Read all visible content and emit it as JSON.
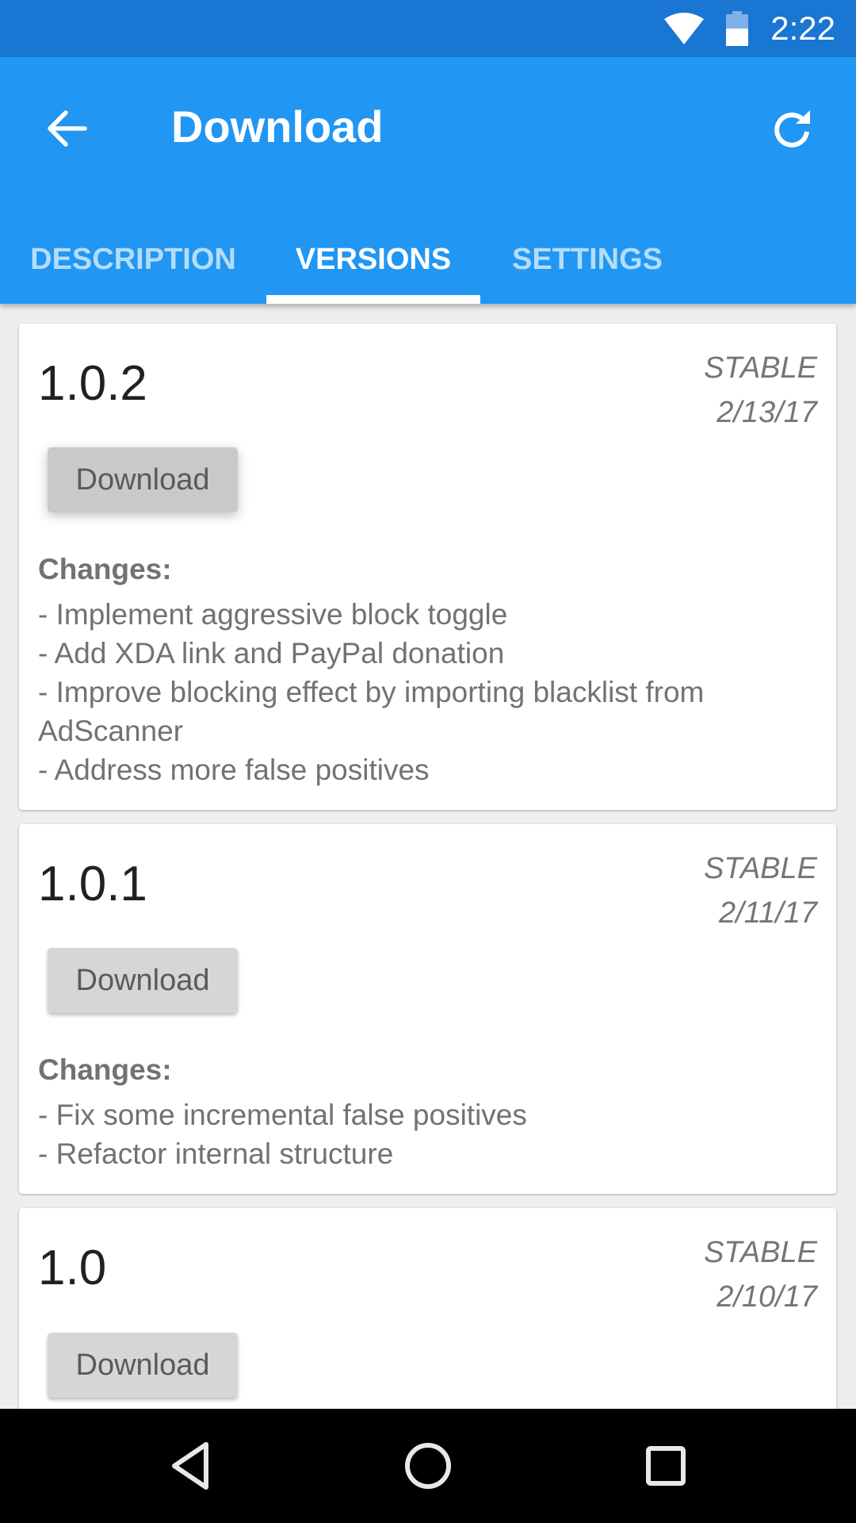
{
  "status_bar": {
    "time": "2:22",
    "icons": [
      "wifi-icon",
      "battery-icon"
    ]
  },
  "toolbar": {
    "back_icon": "arrow-left-icon",
    "title": "Download",
    "refresh_icon": "refresh-icon"
  },
  "tabs": [
    {
      "label": "DESCRIPTION",
      "active": false
    },
    {
      "label": "VERSIONS",
      "active": true
    },
    {
      "label": "SETTINGS",
      "active": false
    }
  ],
  "versions": [
    {
      "version": "1.0.2",
      "channel": "STABLE",
      "date": "2/13/17",
      "button_label": "Download",
      "changes_label": "Changes:",
      "changes": [
        "- Implement aggressive block toggle",
        "- Add XDA link and PayPal donation",
        "- Improve blocking effect by importing blacklist from AdScanner",
        "- Address more false positives"
      ]
    },
    {
      "version": "1.0.1",
      "channel": "STABLE",
      "date": "2/11/17",
      "button_label": "Download",
      "changes_label": "Changes:",
      "changes": [
        "- Fix some incremental false positives",
        "- Refactor internal structure"
      ]
    },
    {
      "version": "1.0",
      "channel": "STABLE",
      "date": "2/10/17",
      "button_label": "Download"
    }
  ],
  "nav_bar": {
    "icons": [
      "back-triangle-icon",
      "home-circle-icon",
      "recents-square-icon"
    ]
  },
  "colors": {
    "status_bar": "#1976D2",
    "toolbar": "#2196F3",
    "tab_inactive": "#B3DDFB",
    "background": "#EEEEEE"
  }
}
